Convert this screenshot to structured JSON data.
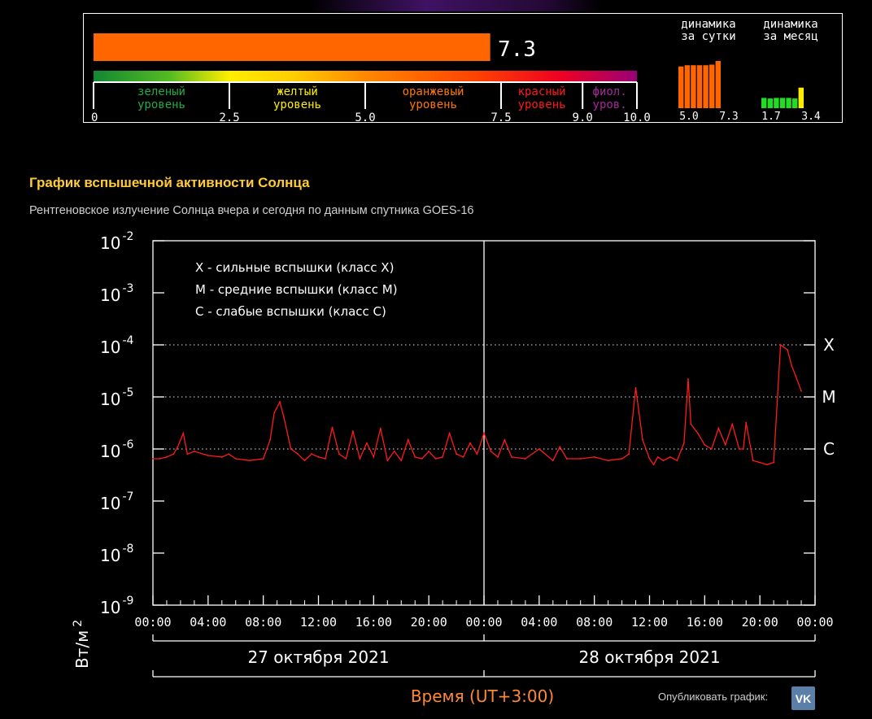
{
  "flare_index": {
    "value": 7.3,
    "value_label": "7.3",
    "bar_color": "#ff6600",
    "scale_max": 10.0,
    "levels": [
      {
        "name": "зеленый",
        "line2": "уровень",
        "color": "#22aa44"
      },
      {
        "name": "желтый",
        "line2": "уровень",
        "color": "#ffee00"
      },
      {
        "name": "оранжевый",
        "line2": "уровень",
        "color": "#ff7700"
      },
      {
        "name": "красный",
        "line2": "уровень",
        "color": "#ff1a1a"
      },
      {
        "name": "фиол.",
        "line2": "уров.",
        "color": "#a52a9a"
      }
    ],
    "scale_ticks": [
      "0",
      "2.5",
      "5.0",
      "7.5",
      "9.0",
      "10.0"
    ],
    "daily": {
      "title1": "динамика",
      "title2": "за сутки",
      "color": "#ff6600",
      "values": [
        6.9,
        7.1,
        7.1,
        7.1,
        7.1,
        7.2,
        7.8
      ],
      "min_label": "5.0",
      "max_label": "7.3"
    },
    "monthly": {
      "title1": "динамика",
      "title2": "за месяц",
      "color": "#22dd22",
      "highlight_color": "#ffee00",
      "values": [
        1.7,
        1.6,
        1.7,
        1.7,
        1.7,
        1.6,
        3.4
      ],
      "min_label": "1.7",
      "max_label": "3.4"
    }
  },
  "chart_title": "График вспышечной активности Солнца",
  "chart_subtitle": "Рентгеновское излучение Солнца вчера и сегодня по данным спутника GOES-16",
  "chart_data": {
    "type": "line",
    "y_scale": "log",
    "ylim": [
      1e-09,
      0.01
    ],
    "y_tick_bases": [
      "10",
      "10",
      "10",
      "10",
      "10",
      "10",
      "10",
      "10"
    ],
    "y_tick_exponents": [
      "-2",
      "-3",
      "-4",
      "-5",
      "-6",
      "-7",
      "-8",
      "-9"
    ],
    "ylabel": "Вт/м",
    "ylabel_exp": "2",
    "xlim_hours": [
      0,
      48
    ],
    "x_tick_labels": [
      "00:00",
      "04:00",
      "08:00",
      "12:00",
      "16:00",
      "20:00",
      "00:00",
      "04:00",
      "08:00",
      "12:00",
      "16:00",
      "20:00",
      "00:00"
    ],
    "day_labels": [
      "27 октября 2021",
      "28 октября 2021"
    ],
    "xlabel": "Время (UT+3:00)",
    "legend": [
      "X - сильные вспышки (класс X)",
      "M - средние вспышки (класс M)",
      "C - слабые вспышки (класс C)"
    ],
    "class_lines": [
      {
        "label": "X",
        "value": 0.0001
      },
      {
        "label": "M",
        "value": 1e-05
      },
      {
        "label": "C",
        "value": 1e-06
      }
    ],
    "series": [
      {
        "color": "#ff1a1a",
        "x_hours": [
          0.0,
          0.5,
          1.0,
          1.5,
          1.8,
          2.2,
          2.5,
          3.0,
          4.0,
          5.0,
          5.5,
          6.0,
          7.0,
          8.0,
          8.5,
          8.8,
          9.2,
          9.5,
          10.0,
          10.5,
          11.0,
          11.5,
          12.0,
          12.5,
          13.0,
          13.5,
          14.0,
          14.5,
          15.0,
          15.5,
          16.0,
          16.5,
          17.0,
          17.5,
          18.0,
          18.5,
          19.0,
          19.5,
          20.0,
          20.5,
          21.0,
          21.5,
          22.0,
          22.5,
          23.0,
          23.5,
          24.0,
          24.5,
          25.0,
          25.5,
          26.0,
          27.0,
          28.0,
          29.0,
          29.5,
          30.0,
          31.0,
          32.0,
          33.0,
          34.0,
          34.5,
          35.0,
          35.5,
          36.0,
          36.3,
          36.6,
          37.0,
          37.5,
          38.0,
          38.5,
          38.8,
          39.0,
          39.5,
          40.0,
          40.5,
          41.0,
          41.5,
          42.0,
          42.5,
          42.8,
          43.0,
          43.5,
          44.0,
          44.5,
          45.0,
          45.5,
          46.0,
          46.3,
          46.6,
          47.0
        ],
        "y_values": [
          6.5e-07,
          6.5e-07,
          7e-07,
          8e-07,
          1.1e-06,
          2e-06,
          8e-07,
          9e-07,
          7.5e-07,
          7e-07,
          8e-07,
          6.5e-07,
          6e-07,
          6.5e-07,
          1.5e-06,
          5e-06,
          8e-06,
          4e-06,
          1e-06,
          8e-07,
          6e-07,
          8e-07,
          7e-07,
          6.5e-07,
          2.6e-06,
          8e-07,
          6.5e-07,
          2.2e-06,
          6.5e-07,
          1.3e-06,
          7e-07,
          2.5e-06,
          6e-07,
          9e-07,
          6e-07,
          1.5e-06,
          7e-07,
          6.5e-07,
          9e-07,
          6.5e-07,
          7e-07,
          2e-06,
          8e-07,
          7e-07,
          1.3e-06,
          8e-07,
          2e-06,
          9e-07,
          7e-07,
          1.5e-06,
          7e-07,
          6.5e-07,
          1e-06,
          6e-07,
          1.1e-06,
          6.5e-07,
          6.5e-07,
          7e-07,
          6e-07,
          6.5e-07,
          8e-07,
          1.5e-05,
          1.5e-06,
          6.5e-07,
          5e-07,
          7e-07,
          6e-07,
          7e-07,
          6e-07,
          1.3e-06,
          2.2e-05,
          3e-06,
          2e-06,
          1.2e-06,
          1e-06,
          2.5e-06,
          1.2e-06,
          3e-06,
          1e-06,
          1e-06,
          3.2e-06,
          6e-07,
          5.5e-07,
          5e-07,
          5.5e-07,
          0.0001,
          8e-05,
          4e-05,
          2.5e-05,
          1.3e-05
        ]
      }
    ]
  },
  "publish": {
    "label": "Опубликовать график:",
    "icon_text": "VK"
  }
}
